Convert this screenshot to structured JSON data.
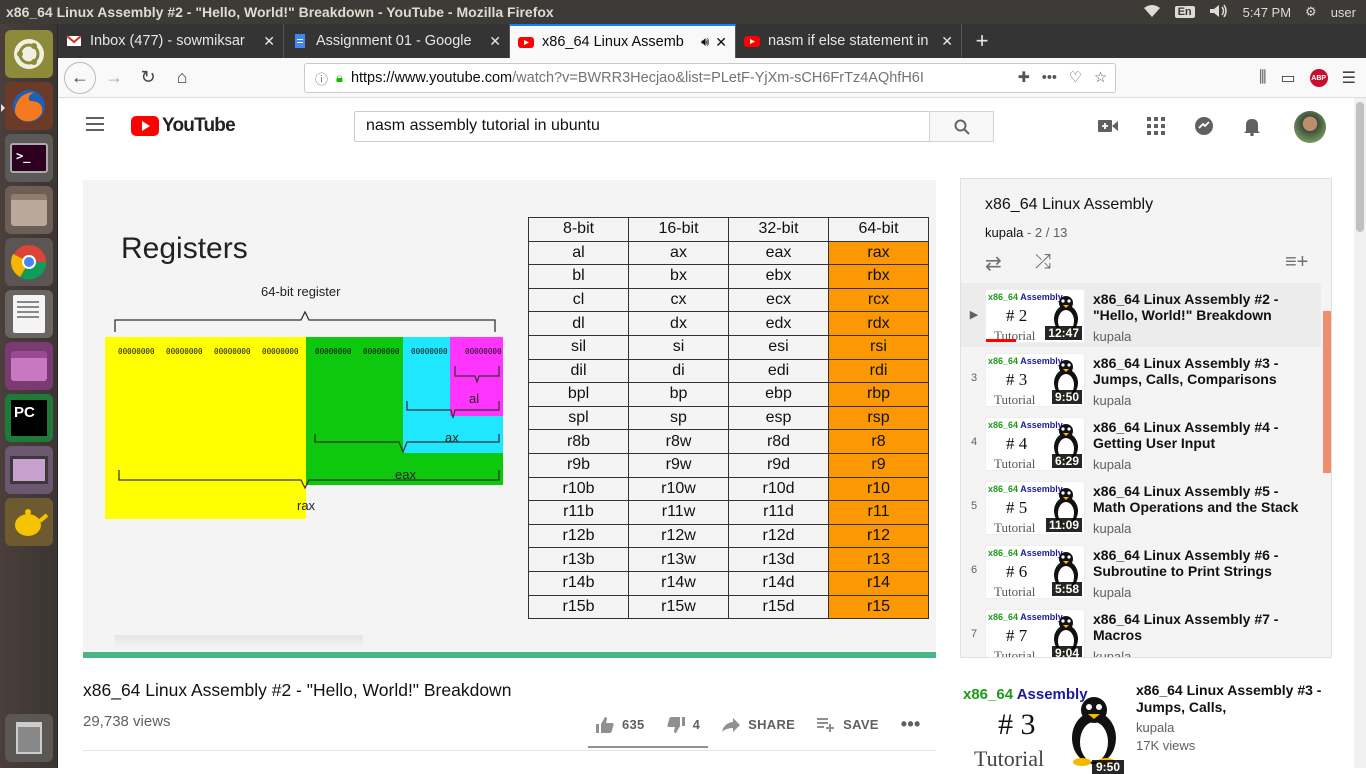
{
  "system": {
    "window_title": "x86_64 Linux Assembly #2 - \"Hello, World!\" Breakdown - YouTube - Mozilla Firefox",
    "keyboard": "En",
    "time": "5:47 PM",
    "user": "user"
  },
  "launcher": {
    "items": [
      "ubuntu-dash",
      "firefox",
      "terminal",
      "files",
      "chrome",
      "text-editor",
      "app-window",
      "pycharm",
      "presentation",
      "teapot-app",
      "trash"
    ]
  },
  "tabs": [
    {
      "label": "Inbox (477) - sowmiksar",
      "icon": "gmail-icon"
    },
    {
      "label": "Assignment 01 - Google",
      "icon": "google-docs-icon"
    },
    {
      "label": "x86_64 Linux Assemb",
      "icon": "youtube-icon"
    },
    {
      "label": "nasm if else statement in",
      "icon": "youtube-icon"
    }
  ],
  "navbar": {
    "url_host": "https://www.youtube.com",
    "url_path": "/watch?v=BWRR3Hecjao&list=PLetF-YjXm-sCH6FrTz4AQhfH6I"
  },
  "youtube": {
    "logo_text": "YouTube",
    "search_value": "nasm assembly tutorial in ubuntu"
  },
  "video": {
    "slide_title": "Registers",
    "diagram": {
      "register_label": "64-bit register",
      "hex_groups": [
        "00000000",
        "00000000",
        "00000000",
        "00000000",
        "00000000",
        "00000000",
        "00000000",
        "00000000"
      ],
      "labels": {
        "al": "al",
        "ax": "ax",
        "eax": "eax",
        "rax": "rax"
      }
    },
    "table": {
      "headers": [
        "8-bit",
        "16-bit",
        "32-bit",
        "64-bit"
      ],
      "rows": [
        [
          "al",
          "ax",
          "eax",
          "rax"
        ],
        [
          "bl",
          "bx",
          "ebx",
          "rbx"
        ],
        [
          "cl",
          "cx",
          "ecx",
          "rcx"
        ],
        [
          "dl",
          "dx",
          "edx",
          "rdx"
        ],
        [
          "sil",
          "si",
          "esi",
          "rsi"
        ],
        [
          "dil",
          "di",
          "edi",
          "rdi"
        ],
        [
          "bpl",
          "bp",
          "ebp",
          "rbp"
        ],
        [
          "spl",
          "sp",
          "esp",
          "rsp"
        ],
        [
          "r8b",
          "r8w",
          "r8d",
          "r8"
        ],
        [
          "r9b",
          "r9w",
          "r9d",
          "r9"
        ],
        [
          "r10b",
          "r10w",
          "r10d",
          "r10"
        ],
        [
          "r11b",
          "r11w",
          "r11d",
          "r11"
        ],
        [
          "r12b",
          "r12w",
          "r12d",
          "r12"
        ],
        [
          "r13b",
          "r13w",
          "r13d",
          "r13"
        ],
        [
          "r14b",
          "r14w",
          "r14d",
          "r14"
        ],
        [
          "r15b",
          "r15w",
          "r15d",
          "r15"
        ]
      ]
    },
    "title": "x86_64 Linux Assembly #2 - \"Hello, World!\" Breakdown",
    "views": "29,738 views",
    "likes": "635",
    "dislikes": "4",
    "share_label": "SHARE",
    "save_label": "SAVE"
  },
  "playlist": {
    "title": "x86_64 Linux Assembly",
    "owner": "kupala",
    "position": "- 2 / 13",
    "thumb_prefix": "x86_64",
    "thumb_word": "Assembly",
    "thumb_tutorial": "Tutorial",
    "items": [
      {
        "index": "▶",
        "num": "# 2",
        "duration": "12:47",
        "title": "x86_64 Linux Assembly #2 - \"Hello, World!\" Breakdown",
        "owner": "kupala"
      },
      {
        "index": "3",
        "num": "# 3",
        "duration": "9:50",
        "title": "x86_64 Linux Assembly #3 - Jumps, Calls, Comparisons",
        "owner": "kupala"
      },
      {
        "index": "4",
        "num": "# 4",
        "duration": "6:29",
        "title": "x86_64 Linux Assembly #4 - Getting User Input",
        "owner": "kupala"
      },
      {
        "index": "5",
        "num": "# 5",
        "duration": "11:09",
        "title": "x86_64 Linux Assembly #5 - Math Operations and the Stack",
        "owner": "kupala"
      },
      {
        "index": "6",
        "num": "# 6",
        "duration": "5:58",
        "title": "x86_64 Linux Assembly #6 - Subroutine to Print Strings",
        "owner": "kupala"
      },
      {
        "index": "7",
        "num": "# 7",
        "duration": "9:04",
        "title": "x86_64 Linux Assembly #7 - Macros",
        "owner": "kupala"
      }
    ]
  },
  "upnext": {
    "thumb_num": "# 3",
    "duration": "9:50",
    "title": "x86_64 Linux Assembly #3 - Jumps, Calls,",
    "owner": "kupala",
    "views": "17K views"
  },
  "colors": {
    "youtube_red": "#ff0000",
    "rax_yellow": "#ffff00",
    "eax_green": "#0ec80e",
    "ax_cyan": "#1fe7ff",
    "al_magenta": "#ff35ff",
    "table_64bit_orange": "#fb9804",
    "progress_green": "#4ab686"
  }
}
